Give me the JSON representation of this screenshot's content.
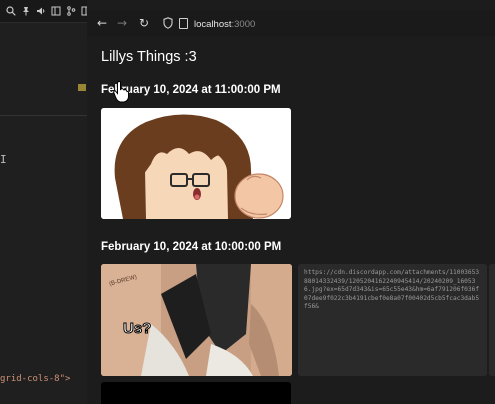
{
  "editor": {
    "code_snippet": "grid-cols-8\">",
    "code_tag": ">"
  },
  "browser": {
    "nav": {
      "back_glyph": "←",
      "forward_glyph": "→",
      "reload_glyph": "↻"
    },
    "url": {
      "host": "localhost",
      "port": ":3000"
    }
  },
  "page": {
    "site_title": "Lillys Things :3",
    "posts": [
      {
        "date": "February 10, 2024 at 11:00:00 PM"
      },
      {
        "date": "February 10, 2024 at 10:00:00 PM",
        "meme_text": "Us?",
        "meme_label": "(B-DREW)",
        "link_text": "https://cdn.discordapp.com/attachments/1100365388014332439/1205204162240945414/20240209_160536.jpg?ex=65d7d343&is=65c55e43&hm=6af791206f036f07dee9f022c3b4191cbef0e8a07f00402d5cb5fcac3dab5f56&"
      }
    ]
  },
  "colors": {
    "page_bg": "#1c1c1c",
    "title_text": "#ffffff",
    "link_card_bg": "#2a2a2a"
  }
}
